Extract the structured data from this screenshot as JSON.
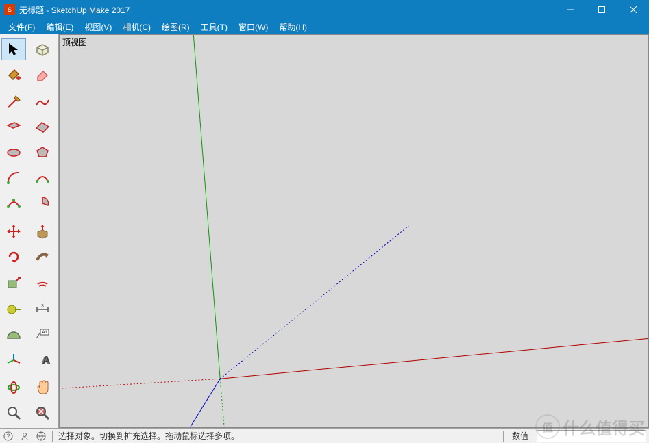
{
  "titlebar": {
    "title": "无标题 - SketchUp Make 2017"
  },
  "menus": [
    {
      "label": "文件(F)"
    },
    {
      "label": "编辑(E)"
    },
    {
      "label": "视图(V)"
    },
    {
      "label": "相机(C)"
    },
    {
      "label": "绘图(R)"
    },
    {
      "label": "工具(T)"
    },
    {
      "label": "窗口(W)"
    },
    {
      "label": "帮助(H)"
    }
  ],
  "viewport": {
    "view_label": "顶视图"
  },
  "status": {
    "hint": "选择对象。切换到扩充选择。拖动鼠标选择多项。",
    "value_label": "数值",
    "value": ""
  },
  "watermark": {
    "text": "什么值得买",
    "badge": "值"
  },
  "tools": {
    "select": "选择",
    "component": "制作组件",
    "paint": "材质",
    "eraser": "橡皮擦",
    "line": "直线",
    "freehand": "手绘线",
    "rectangle": "矩形",
    "rect_rot": "旋转矩形",
    "circle": "圆",
    "polygon": "多边形",
    "arc": "圆弧",
    "arc2": "两点圆弧",
    "arc3": "三点圆弧",
    "pie": "饼形",
    "move": "移动",
    "pushpull": "推拉",
    "rotate": "旋转",
    "followme": "路径跟随",
    "scale": "缩放",
    "offset": "偏移",
    "tape": "卷尺",
    "dimension": "尺寸",
    "protractor": "量角器",
    "text": "文字",
    "axes": "坐标轴",
    "text3d": "三维文字",
    "orbit": "环绕",
    "pan": "平移",
    "zoom": "缩放视图",
    "zoom_ext": "充满视窗"
  }
}
